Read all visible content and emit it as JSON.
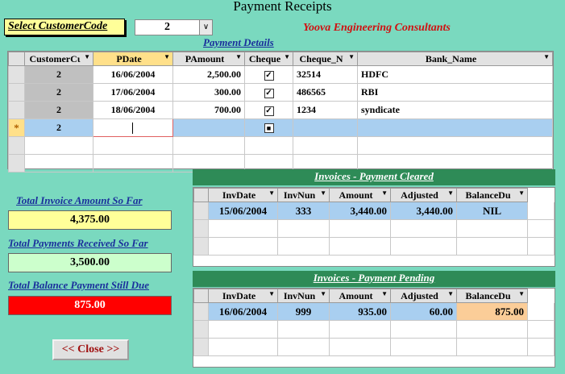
{
  "window": {
    "title": "Payment Receipts"
  },
  "customer": {
    "label": "Select CustomerCode",
    "value": "2",
    "dropdown_glyph": "∨"
  },
  "company_name": "Yoova Engineering Consultants",
  "payment_details": {
    "heading": "Payment Details",
    "columns": [
      "CustomerCι",
      "PDate",
      "PAmount",
      "Cheque",
      "Cheque_N",
      "Bank_Name"
    ],
    "rows": [
      {
        "customer": "2",
        "pdate": "16/06/2004",
        "pamount": "2,500.00",
        "cheque": true,
        "cheque_no": "32514",
        "bank": "HDFC"
      },
      {
        "customer": "2",
        "pdate": "17/06/2004",
        "pamount": "300.00",
        "cheque": true,
        "cheque_no": "486565",
        "bank": "RBI"
      },
      {
        "customer": "2",
        "pdate": "18/06/2004",
        "pamount": "700.00",
        "cheque": true,
        "cheque_no": "1234",
        "bank": "syndicate"
      }
    ],
    "new_row": {
      "marker": "*",
      "customer": "2"
    }
  },
  "invoices_cleared": {
    "heading": "Invoices - Payment Cleared",
    "columns": [
      "InvDate",
      "InvNun",
      "Amount",
      "Adjusted",
      "BalanceDu"
    ],
    "rows": [
      {
        "inv_date": "15/06/2004",
        "inv_num": "333",
        "amount": "3,440.00",
        "adjusted": "3,440.00",
        "balance_due": "NIL"
      }
    ]
  },
  "invoices_pending": {
    "heading": "Invoices - Payment Pending",
    "columns": [
      "InvDate",
      "InvNun",
      "Amount",
      "Adjusted",
      "BalanceDu"
    ],
    "rows": [
      {
        "inv_date": "16/06/2004",
        "inv_num": "999",
        "amount": "935.00",
        "adjusted": "60.00",
        "balance_due": "875.00"
      }
    ]
  },
  "summary": {
    "total_invoice_label": "Total Invoice Amount So Far",
    "total_invoice_value": "4,375.00",
    "total_payments_label": "Total Payments Received So Far",
    "total_payments_value": "3,500.00",
    "balance_label": "Total Balance Payment Still Due",
    "balance_value": "875.00"
  },
  "close_button": "<< Close >>",
  "colors": {
    "background": "#7ad9bf",
    "accent_green": "#2e8b57",
    "balance_red": "#ff0000",
    "invoice_yellow": "#ffff99",
    "payments_green": "#ccffcc"
  }
}
